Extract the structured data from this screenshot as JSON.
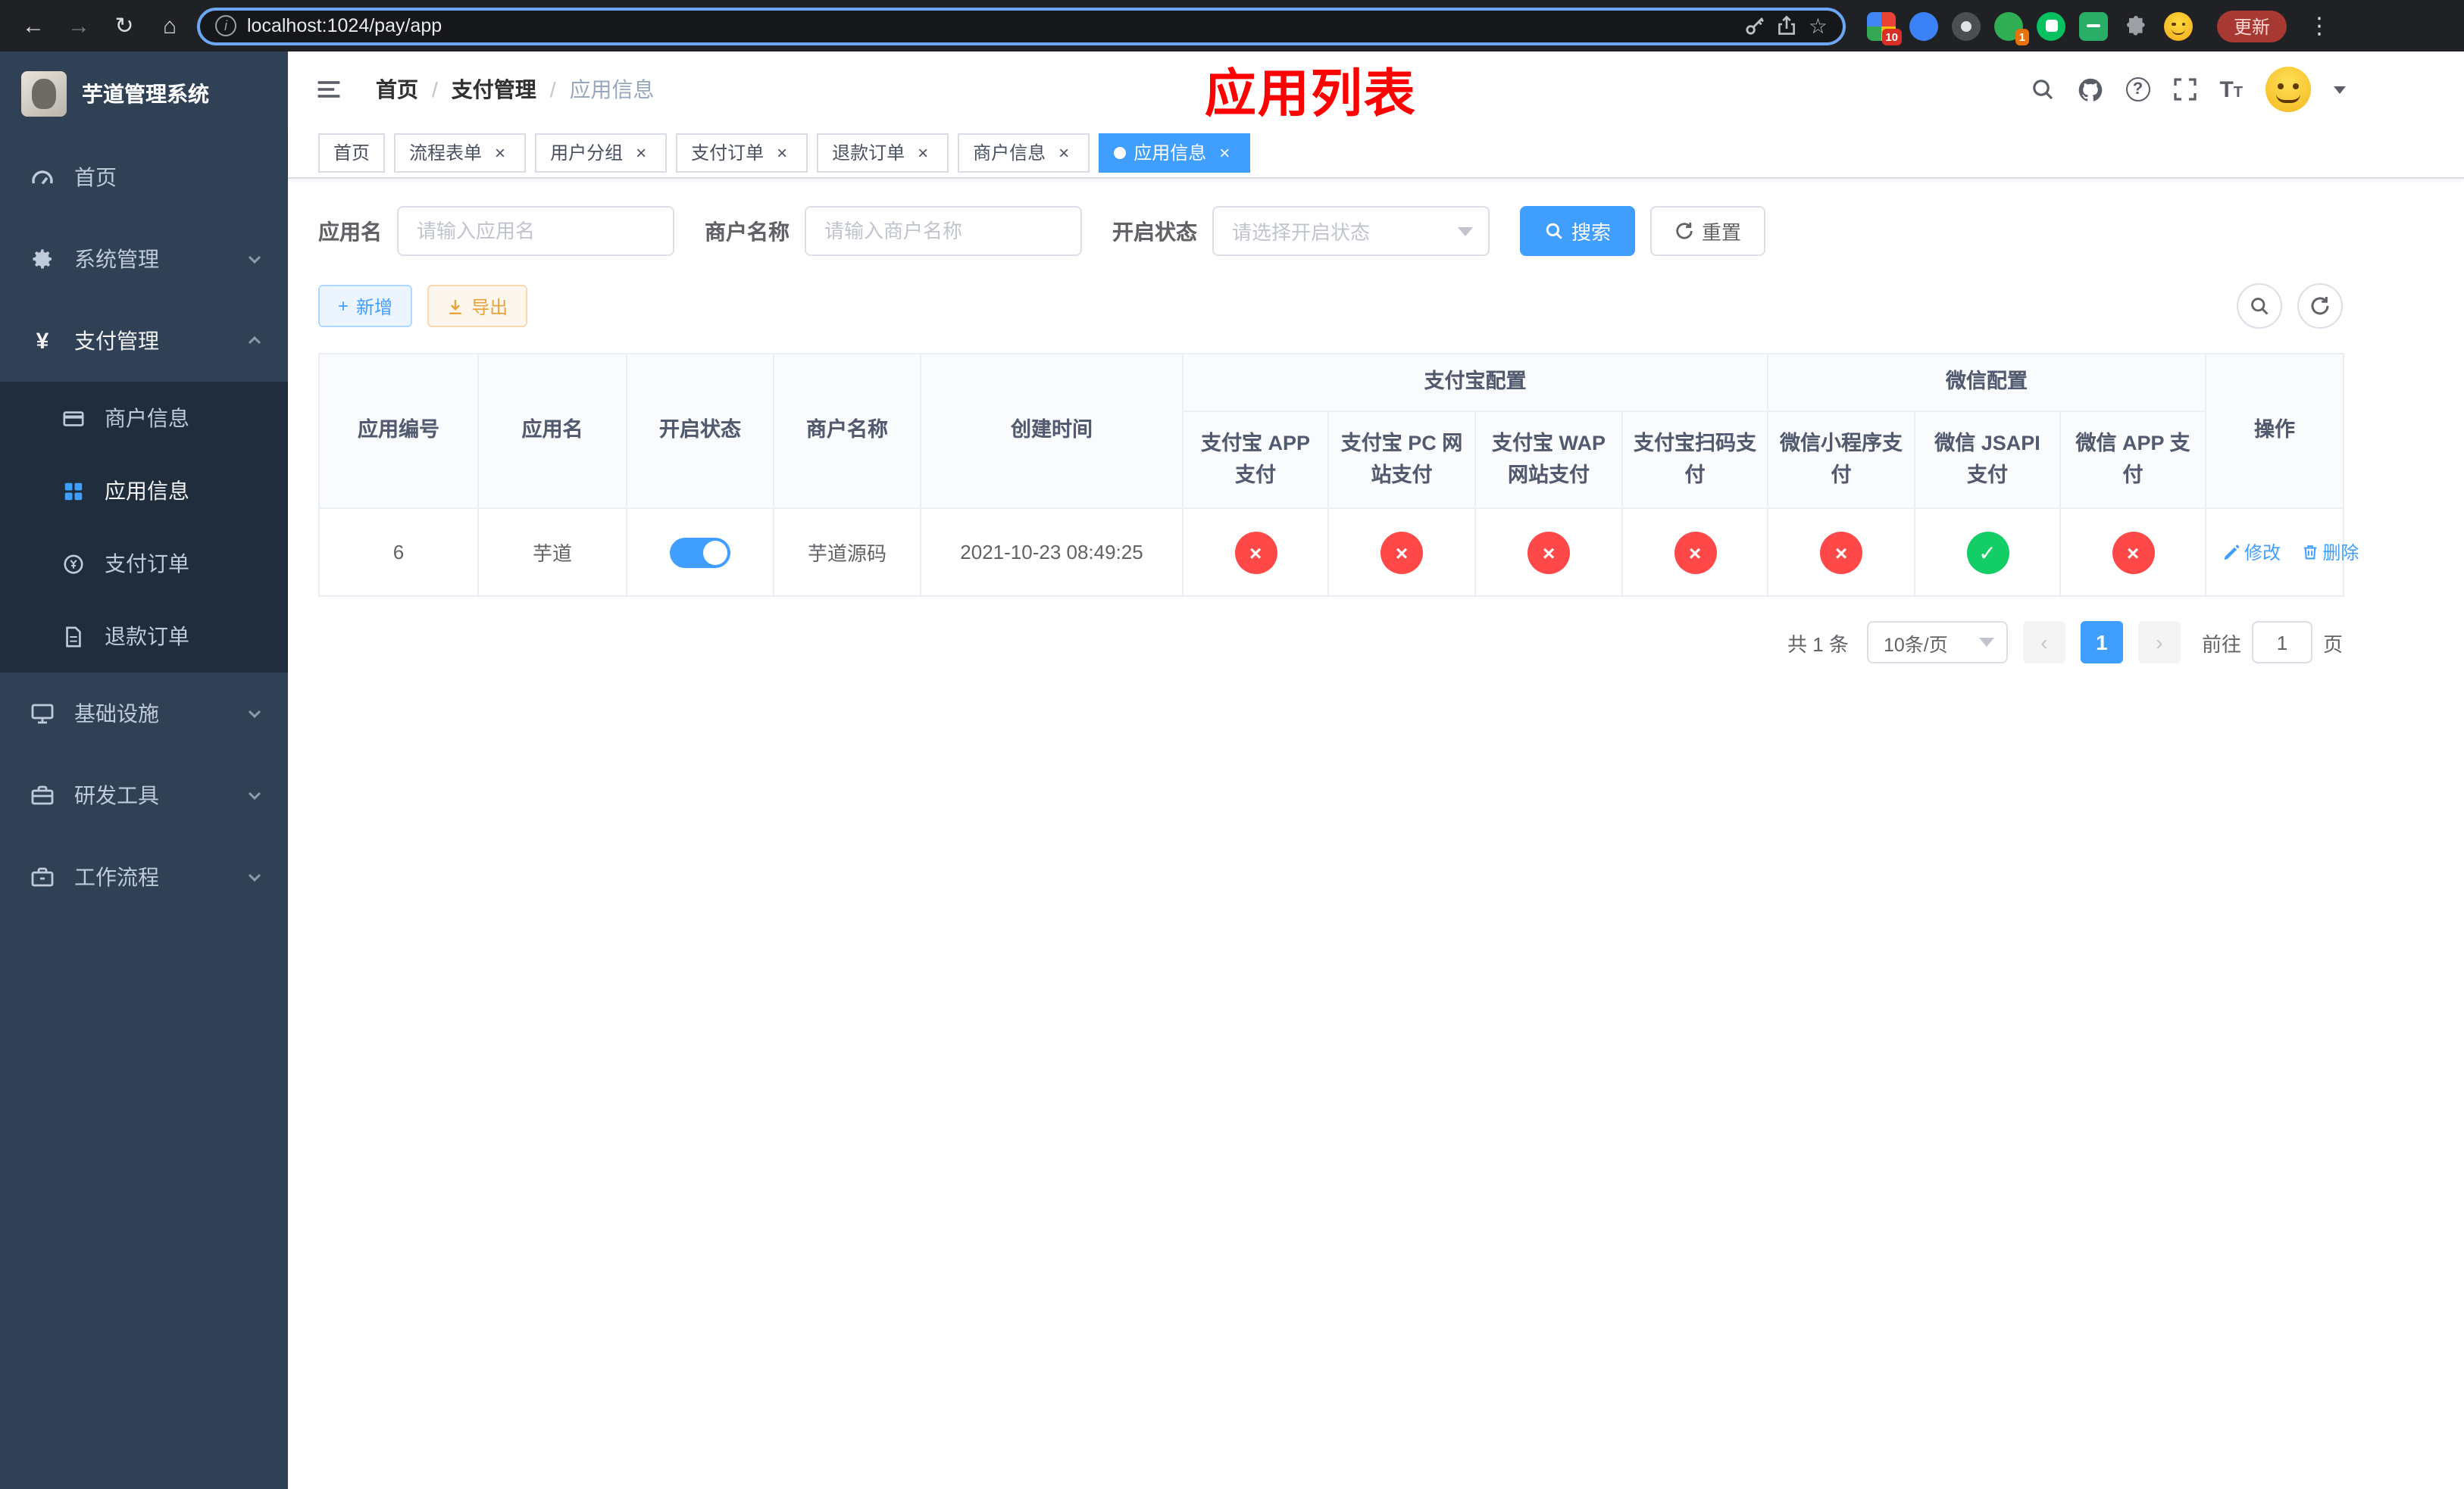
{
  "browser": {
    "url": "localhost:1024/pay/app",
    "update_label": "更新",
    "extension_badge_apps": "10",
    "extension_badge_green": "1"
  },
  "icons": {
    "back": "←",
    "forward": "→",
    "reload": "↻",
    "home": "⌂",
    "info": "i",
    "star": "☆",
    "kebab": "⋮",
    "plus": "+",
    "yen": "¥",
    "check": "✓",
    "cross": "×",
    "prev": "‹",
    "next": "›",
    "question": "?",
    "t_big": "T",
    "t_small": "T"
  },
  "sidebar": {
    "app_title": "芋道管理系统",
    "menu": [
      {
        "label": "首页"
      },
      {
        "label": "系统管理"
      },
      {
        "label": "支付管理"
      },
      {
        "label": "基础设施"
      },
      {
        "label": "研发工具"
      },
      {
        "label": "工作流程"
      }
    ],
    "payment_submenu": [
      {
        "label": "商户信息"
      },
      {
        "label": "应用信息"
      },
      {
        "label": "支付订单"
      },
      {
        "label": "退款订单"
      }
    ]
  },
  "navbar": {
    "breadcrumb": [
      {
        "label": "首页"
      },
      {
        "label": "支付管理"
      },
      {
        "label": "应用信息"
      }
    ],
    "annotation_title": "应用列表"
  },
  "tags": [
    {
      "label": "首页"
    },
    {
      "label": "流程表单"
    },
    {
      "label": "用户分组"
    },
    {
      "label": "支付订单"
    },
    {
      "label": "退款订单"
    },
    {
      "label": "商户信息"
    },
    {
      "label": "应用信息"
    }
  ],
  "filters": {
    "app_name_label": "应用名",
    "app_name_placeholder": "请输入应用名",
    "merchant_label": "商户名称",
    "merchant_placeholder": "请输入商户名称",
    "status_label": "开启状态",
    "status_placeholder": "请选择开启状态",
    "search_label": "搜索",
    "reset_label": "重置"
  },
  "toolbar": {
    "add_label": "新增",
    "export_label": "导出"
  },
  "table": {
    "columns": {
      "app_id": "应用编号",
      "app_name": "应用名",
      "status": "开启状态",
      "merchant": "商户名称",
      "created": "创建时间",
      "alipay_group": "支付宝配置",
      "wechat_group": "微信配置",
      "alipay_app": "支付宝 APP 支付",
      "alipay_pc": "支付宝 PC 网站支付",
      "alipay_wap": "支付宝 WAP 网站支付",
      "alipay_qr": "支付宝扫码支付",
      "wx_mini": "微信小程序支付",
      "wx_jsapi": "微信 JSAPI 支付",
      "wx_app": "微信 APP 支付",
      "actions": "操作"
    },
    "rows": [
      {
        "app_id": "6",
        "app_name": "芋道",
        "status_on": true,
        "merchant": "芋道源码",
        "created": "2021-10-23 08:49:25",
        "configs": {
          "alipay_app": "disabled",
          "alipay_pc": "disabled",
          "alipay_wap": "disabled",
          "alipay_qr": "disabled",
          "wx_mini": "disabled",
          "wx_jsapi": "enabled",
          "wx_app": "disabled"
        },
        "edit_label": "修改",
        "delete_label": "删除"
      }
    ]
  },
  "pagination": {
    "total_text": "共 1 条",
    "page_size": "10条/页",
    "page": "1",
    "goto_label": "前往",
    "goto_value": "1",
    "page_unit": "页"
  },
  "colors": {
    "primary": "#409eff",
    "success": "#13ce66",
    "danger": "#ff4949",
    "warning": "#e6a23c",
    "annotation": "#ff0000",
    "sidebar_bg": "#304156",
    "submenu_bg": "#1f2d3d"
  }
}
